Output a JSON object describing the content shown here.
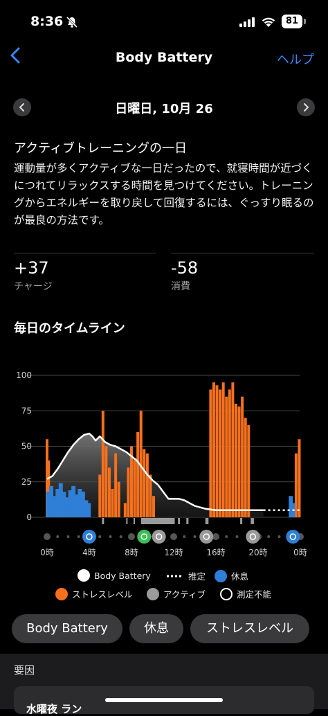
{
  "status": {
    "time": "8:36",
    "battery": "81"
  },
  "nav": {
    "back_glyph": "<",
    "title": "Body Battery",
    "help": "ヘルプ"
  },
  "date": {
    "prev_glyph": "‹",
    "label": "日曜日, 10月 26",
    "next_glyph": "›"
  },
  "summary": {
    "headline": "アクティブトレーニングの一日",
    "desc": "運動量が多くアクティブな一日だったので、就寝時間が近づくにつれてリラックスする時間を見つけてください。トレーニングからエネルギーを取り戻して回復するには、ぐっすり眠るのが最良の方法です。"
  },
  "stats": {
    "charge": {
      "value": "+37",
      "label": "チャージ"
    },
    "drain": {
      "value": "-58",
      "label": "消費"
    }
  },
  "timeline_title": "毎日のタイムライン",
  "colors": {
    "accent": "#3a86f6",
    "stress": "#f5701c",
    "rest": "#2f7fd6",
    "active": "#9a9a9a",
    "body_battery": "#ffffff"
  },
  "events": [
    {
      "hour": 4,
      "type": "sleep-wake",
      "icon": "clock-icon",
      "color": "#2f7fd6"
    },
    {
      "hour": 9.2,
      "type": "run",
      "icon": "running-icon",
      "color": "#3cbf55"
    },
    {
      "hour": 10.6,
      "type": "active",
      "icon": "walking-icon",
      "color": "#9a9a9a"
    },
    {
      "hour": 15.1,
      "type": "active",
      "icon": "walking-icon",
      "color": "#9a9a9a"
    },
    {
      "hour": 19.5,
      "type": "active",
      "icon": "walking-icon",
      "color": "#9a9a9a"
    },
    {
      "hour": 23.3,
      "type": "sleep",
      "icon": "sleep-icon",
      "color": "#2f7fd6"
    }
  ],
  "chart_data": {
    "type": "area",
    "ylim": [
      0,
      100
    ],
    "yticks": [
      0,
      25,
      50,
      75,
      100
    ],
    "xticks": [
      "0時",
      "4時",
      "8時",
      "12時",
      "16時",
      "20時",
      "0時"
    ],
    "xrange_hours": [
      0,
      24
    ],
    "grid": true,
    "legend_position": "bottom",
    "body_battery": {
      "x_hours": [
        0,
        0.5,
        1,
        1.5,
        2,
        2.5,
        3,
        3.5,
        4,
        4.3,
        4.6,
        5,
        5.5,
        6,
        6.5,
        7,
        7.5,
        8,
        8.5,
        9,
        9.5,
        10,
        10.5,
        11,
        11.5,
        12,
        12.5,
        13,
        13.5,
        14,
        15,
        16,
        17,
        18,
        19,
        20,
        20.5
      ],
      "values": [
        27,
        29,
        34,
        40,
        46,
        51,
        55,
        58,
        59,
        57,
        54,
        57,
        53,
        51,
        50,
        48,
        46,
        43,
        40,
        35,
        30,
        26,
        23,
        18,
        13,
        13,
        13,
        12,
        10,
        8,
        6,
        5,
        5,
        5,
        5,
        5,
        5
      ]
    },
    "body_battery_estimated": {
      "x_hours": [
        20.5,
        24
      ],
      "values": [
        5,
        5
      ]
    },
    "stress": {
      "x_hours": [
        0,
        0.15,
        0.3,
        0.5,
        0.8,
        1.1,
        1.4,
        1.7,
        2,
        2.3,
        2.6,
        2.9,
        3.2,
        3.5,
        3.8,
        4.1,
        4.4,
        4.7,
        5,
        5.3,
        5.6,
        5.9,
        6.2,
        6.5,
        6.8,
        7.1,
        7.4,
        7.7,
        8,
        8.3,
        8.6,
        8.9,
        9.2,
        9.5,
        9.8,
        10.1,
        10.4,
        10.7,
        11,
        11.3,
        11.6,
        11.9,
        12.2,
        12.5,
        12.8,
        13.1,
        13.4,
        13.7,
        14,
        14.3,
        14.6,
        14.9,
        15.2,
        15.5,
        15.8,
        16.1,
        16.4,
        16.7,
        17,
        17.3,
        17.6,
        17.9,
        18.2,
        18.5,
        18.8,
        19.1,
        19.4,
        19.7,
        20,
        20.3,
        20.6,
        20.9,
        21.2,
        21.5,
        21.8,
        22.1,
        22.4,
        22.7,
        23,
        23.3,
        23.6,
        23.9
      ],
      "values": [
        55,
        40,
        0,
        0,
        0,
        0,
        0,
        0,
        0,
        0,
        0,
        0,
        0,
        0,
        0,
        0,
        0,
        0,
        30,
        75,
        50,
        35,
        20,
        45,
        25,
        0,
        10,
        35,
        50,
        40,
        60,
        75,
        48,
        45,
        30,
        15,
        0,
        0,
        0,
        0,
        0,
        0,
        0,
        0,
        0,
        0,
        0,
        0,
        0,
        0,
        0,
        0,
        0,
        90,
        95,
        93,
        90,
        95,
        85,
        90,
        95,
        80,
        78,
        85,
        70,
        65,
        0,
        0,
        0,
        0,
        0,
        0,
        0,
        0,
        0,
        0,
        0,
        0,
        0,
        0,
        45,
        55
      ]
    },
    "rest": {
      "x_hours": [
        0.1,
        0.4,
        0.7,
        1,
        1.3,
        1.6,
        1.9,
        2.2,
        2.5,
        2.8,
        3.1,
        3.4,
        3.7,
        3.95,
        23.1,
        23.3
      ],
      "values": [
        18,
        22,
        15,
        20,
        24,
        18,
        14,
        19,
        22,
        16,
        20,
        18,
        12,
        10,
        15,
        10
      ]
    },
    "active_periods_hours": [
      [
        5.2,
        5.4
      ],
      [
        7.5,
        7.6
      ],
      [
        8.2,
        8.3
      ],
      [
        8.9,
        12.1
      ],
      [
        12.4,
        12.6
      ],
      [
        13.2,
        13.4
      ],
      [
        15.0,
        15.3
      ],
      [
        18.3,
        18.5
      ],
      [
        19.3,
        19.6
      ]
    ],
    "legend": [
      {
        "label": "Body Battery",
        "swatch": "white-dot"
      },
      {
        "label": "推定",
        "swatch": "dotted-line"
      },
      {
        "label": "休息",
        "swatch": "blue-dot"
      },
      {
        "label": "ストレスレベル",
        "swatch": "orange-dot"
      },
      {
        "label": "アクティブ",
        "swatch": "gray-dot"
      },
      {
        "label": "測定不能",
        "swatch": "ring-dot"
      }
    ]
  },
  "tabs": [
    "Body Battery",
    "休息",
    "ストレスレベル"
  ],
  "factors": {
    "heading": "要因",
    "first_item": "水曜夜 ラン"
  }
}
